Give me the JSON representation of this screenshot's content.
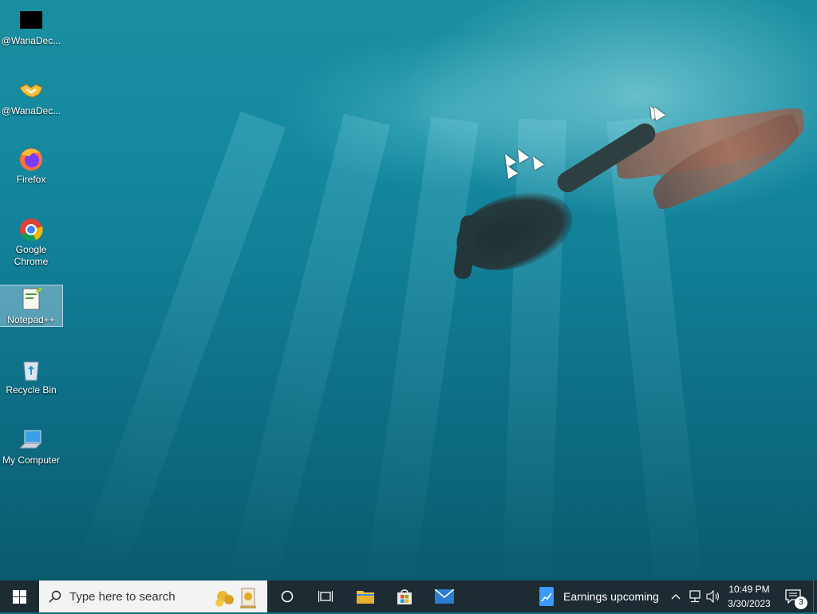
{
  "desktop": {
    "icons": [
      {
        "label": "@WanaDec...",
        "icon": "black-window-icon"
      },
      {
        "label": "@WanaDec...",
        "icon": "handshake-icon"
      },
      {
        "label": "Firefox",
        "icon": "firefox-icon"
      },
      {
        "label": "Google Chrome",
        "icon": "chrome-icon"
      },
      {
        "label": "Notepad++",
        "icon": "notepad-plus-plus-icon",
        "selected": true
      },
      {
        "label": "Recycle Bin",
        "icon": "recycle-bin-icon"
      },
      {
        "label": "My Computer",
        "icon": "computer-icon"
      }
    ]
  },
  "taskbar": {
    "start_icon": "windows-start-icon",
    "search": {
      "placeholder": "Type here to search",
      "icon": "search-icon"
    },
    "pinned": [
      {
        "name": "cortana",
        "icon": "cortana-circle-icon"
      },
      {
        "name": "task-view",
        "icon": "task-view-icon"
      },
      {
        "name": "file-explorer",
        "icon": "folder-icon"
      },
      {
        "name": "microsoft-store",
        "icon": "store-icon"
      },
      {
        "name": "mail",
        "icon": "mail-icon"
      }
    ],
    "news": {
      "label": "Earnings upcoming",
      "icon": "stocks-chart-icon"
    },
    "tray": {
      "time": "10:49 PM",
      "date": "3/30/2023",
      "notification_count": "3"
    }
  },
  "colors": {
    "taskbar": "#1d2b33",
    "water_top": "#1a8fa0",
    "water_bottom": "#095a6c",
    "selection": "#b4d2e6"
  }
}
